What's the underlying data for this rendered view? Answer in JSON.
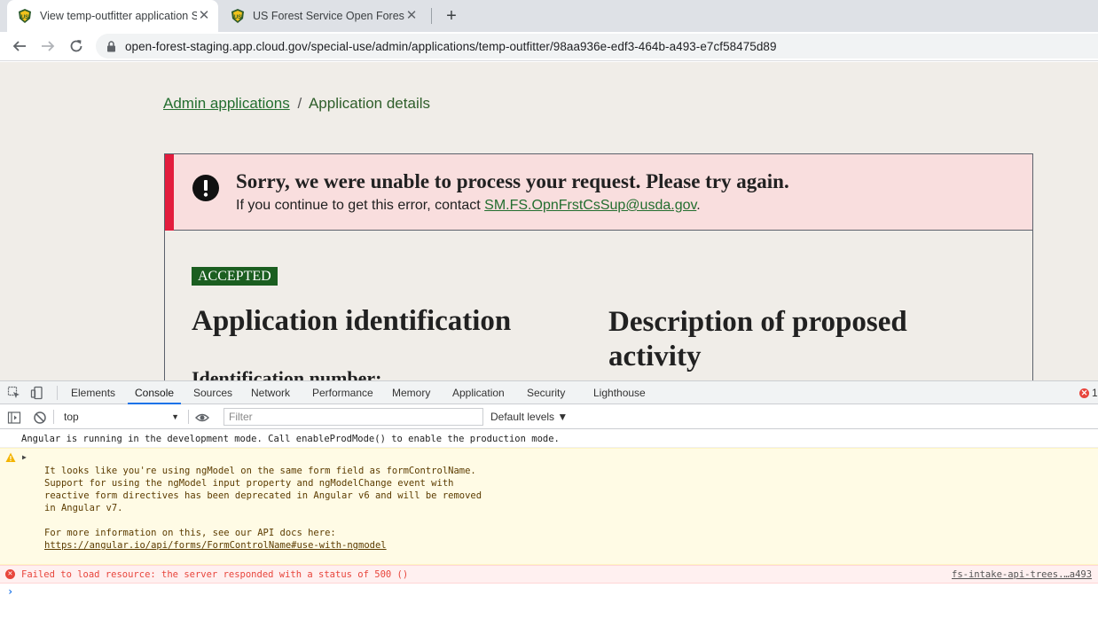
{
  "browser": {
    "tabs": [
      {
        "title": "View temp-outfitter application S",
        "close": "✕",
        "active": true
      },
      {
        "title": "US Forest Service Open Forest",
        "close": "✕",
        "active": false
      }
    ],
    "new_tab": "+",
    "url": "open-forest-staging.app.cloud.gov/special-use/admin/applications/temp-outfitter/98aa936e-edf3-464b-a493-e7cf58475d89"
  },
  "page": {
    "breadcrumb": {
      "link": "Admin applications",
      "separator": "/",
      "current": "Application details"
    },
    "alert": {
      "heading": "Sorry, we were unable to process your request. Please try again.",
      "text_before": "If you continue to get this error, contact ",
      "email": "SM.FS.OpnFrstCsSup@usda.gov",
      "text_after": "."
    },
    "status_badge": "ACCEPTED",
    "heading_left": "Application identification",
    "heading_right": "Description of proposed activity",
    "subheading": "Identification number:"
  },
  "devtools": {
    "tabs": [
      "Elements",
      "Console",
      "Sources",
      "Network",
      "Performance",
      "Memory",
      "Application",
      "Security",
      "Lighthouse"
    ],
    "active_tab": "Console",
    "error_count": "1",
    "context": "top",
    "filter_placeholder": "Filter",
    "levels": "Default levels ▼",
    "messages": {
      "info": "Angular is running in the development mode. Call enableProdMode() to enable the production mode.",
      "warning": "It looks like you're using ngModel on the same form field as formControlName.\nSupport for using the ngModel input property and ngModelChange event with\nreactive form directives has been deprecated in Angular v6 and will be removed\nin Angular v7.\n\nFor more information on this, see our API docs here:",
      "warning_link": "https://angular.io/api/forms/FormControlName#use-with-ngmodel",
      "error": "Failed to load resource: the server responded with a status of 500 ()",
      "error_source": "fs-intake-api-trees.…a493"
    },
    "prompt": "›"
  },
  "colors": {
    "link_green": "#236e2f",
    "badge_green": "#1b5e20",
    "alert_red": "#e31c3d",
    "alert_bg": "#f9dede",
    "page_bg": "#f0ede8",
    "devtools_blue": "#1a73e8"
  }
}
